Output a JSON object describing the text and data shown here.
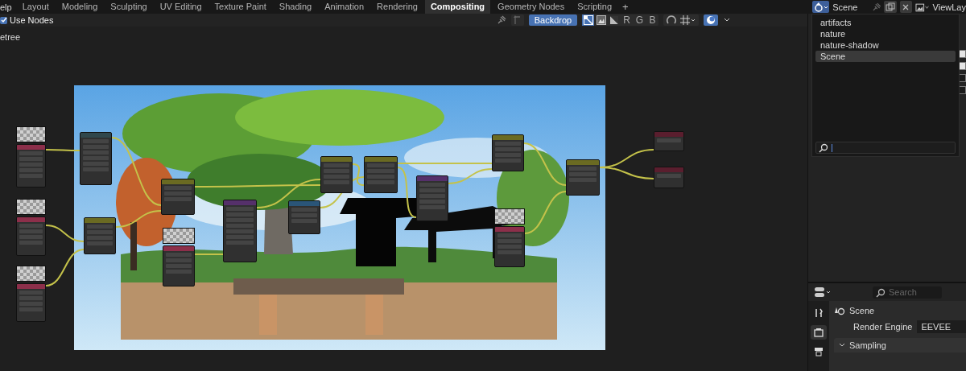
{
  "top_bar": {
    "menu_fragment": "elp",
    "tabs": [
      {
        "label": "Layout",
        "selected": false
      },
      {
        "label": "Modeling",
        "selected": false
      },
      {
        "label": "Sculpting",
        "selected": false
      },
      {
        "label": "UV Editing",
        "selected": false
      },
      {
        "label": "Texture Paint",
        "selected": false
      },
      {
        "label": "Shading",
        "selected": false
      },
      {
        "label": "Animation",
        "selected": false
      },
      {
        "label": "Rendering",
        "selected": false
      },
      {
        "label": "Compositing",
        "selected": true
      },
      {
        "label": "Geometry Nodes",
        "selected": false
      },
      {
        "label": "Scripting",
        "selected": false
      }
    ],
    "add_tab": "+",
    "scene": "Scene",
    "view_layer": "ViewLay"
  },
  "node_header": {
    "use_nodes": {
      "label": "Use Nodes",
      "checked": true
    },
    "backdrop": {
      "label": "Backdrop",
      "on": true
    },
    "channels": [
      {
        "kind": "color-alpha",
        "selected": true
      },
      {
        "kind": "color",
        "selected": false
      },
      {
        "kind": "alpha",
        "selected": false
      },
      {
        "kind": "text",
        "label": "R",
        "selected": false
      },
      {
        "kind": "text",
        "label": "G",
        "selected": false
      },
      {
        "kind": "text",
        "label": "B",
        "selected": false
      }
    ]
  },
  "breadcrumb": "etree",
  "nodes": [
    {
      "kind": "image",
      "color": "#8c2f4a"
    },
    {
      "kind": "node",
      "color": "#30474c"
    },
    {
      "kind": "node",
      "color": "#6a6a22"
    },
    {
      "kind": "image",
      "color": "#8c2f4a"
    },
    {
      "kind": "node",
      "color": "#6a6a22"
    },
    {
      "kind": "image",
      "color": "#8c2f4a"
    },
    {
      "kind": "image",
      "color": "#8c2f4a"
    },
    {
      "kind": "node",
      "color": "#55306a"
    },
    {
      "kind": "node",
      "color": "#6a6a22"
    },
    {
      "kind": "node",
      "color": "#6a6a22"
    },
    {
      "kind": "node",
      "color": "#2a5578"
    },
    {
      "kind": "node",
      "color": "#55306a"
    },
    {
      "kind": "node",
      "color": "#6a6a22"
    },
    {
      "kind": "image",
      "color": "#8c2f4a"
    },
    {
      "kind": "node",
      "color": "#6a6a22"
    },
    {
      "kind": "node",
      "color": "#5a1e2e"
    },
    {
      "kind": "node",
      "color": "#5a1e2e"
    }
  ],
  "scene_menu": {
    "items": [
      {
        "label": "artifacts",
        "selected": false
      },
      {
        "label": "nature",
        "selected": false
      },
      {
        "label": "nature-shadow",
        "selected": false
      },
      {
        "label": "Scene",
        "selected": true
      }
    ]
  },
  "outliner_checkboxes": [
    {
      "checked": true
    },
    {
      "checked": true
    },
    {
      "checked": false
    },
    {
      "checked": false
    }
  ],
  "properties": {
    "search": {
      "placeholder": "Search"
    },
    "tabs": [
      {
        "kind": "tool",
        "selected": false
      },
      {
        "kind": "render",
        "selected": true
      },
      {
        "kind": "output",
        "selected": false
      }
    ],
    "title": "Scene",
    "fields": [
      {
        "label": "Render Engine",
        "value": "EEVEE"
      }
    ],
    "panels": [
      {
        "label": "Sampling",
        "expanded": true
      }
    ]
  }
}
